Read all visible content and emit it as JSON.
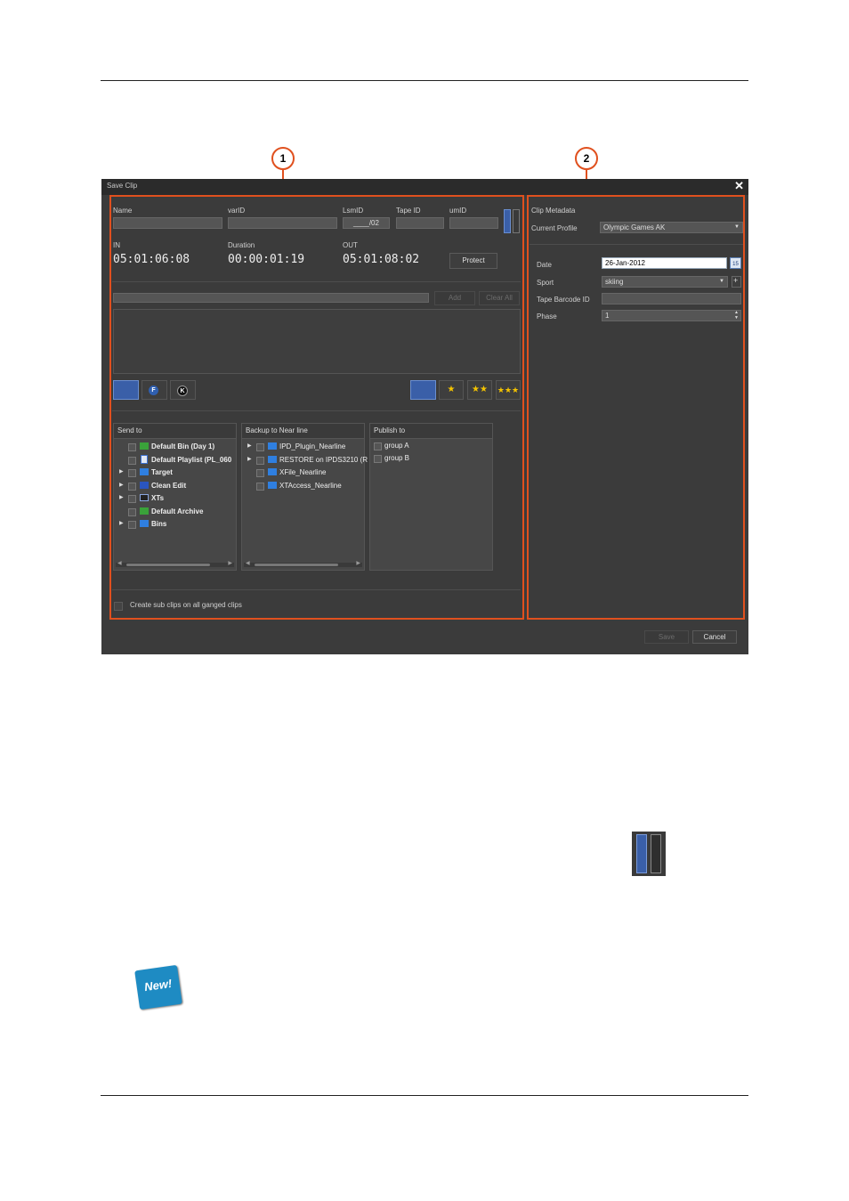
{
  "callouts": [
    "1",
    "2"
  ],
  "dialog": {
    "title": "Save Clip",
    "close_glyph": "✕",
    "fields": {
      "name_label": "Name",
      "varid_label": "varID",
      "lsmid_label": "LsmID",
      "lsmid_value": "____/02",
      "tapeid_label": "Tape ID",
      "umid_label": "umID"
    },
    "timecodes": {
      "in_label": "IN",
      "in_value": "05:01:06:08",
      "duration_label": "Duration",
      "duration_value": "00:00:01:19",
      "out_label": "OUT",
      "out_value": "05:01:08:02",
      "protect_label": "Protect"
    },
    "keywords": {
      "add_label": "Add",
      "clear_all_label": "Clear All"
    },
    "rating": {
      "f_label": "F",
      "k_label": "K",
      "one_star": "★",
      "two_stars": "★★",
      "three_stars": "★★★"
    },
    "send_to": {
      "header": "Send to",
      "items": [
        {
          "label": "Default Bin (Day 1)",
          "icon": "green-folder-icon",
          "expandable": false
        },
        {
          "label": "Default Playlist (PL_060",
          "icon": "playlist-icon",
          "expandable": false
        },
        {
          "label": "Target",
          "icon": "blue-folder-icon",
          "expandable": true
        },
        {
          "label": "Clean Edit",
          "icon": "clean-edit-icon",
          "expandable": true
        },
        {
          "label": "XTs",
          "icon": "xt-icon",
          "expandable": true
        },
        {
          "label": "Default Archive",
          "icon": "green-folder-icon",
          "expandable": false
        },
        {
          "label": "Bins",
          "icon": "blue-folder-icon",
          "expandable": true
        }
      ]
    },
    "backup": {
      "header": "Backup to Near line",
      "items": [
        {
          "label": "IPD_Plugin_Nearline",
          "expandable": true
        },
        {
          "label": "RESTORE on IPDS3210 (R",
          "expandable": true
        },
        {
          "label": "XFile_Nearline",
          "expandable": false
        },
        {
          "label": "XTAccess_Nearline",
          "expandable": false
        }
      ]
    },
    "publish": {
      "header": "Publish to",
      "items": [
        "group A",
        "group B"
      ]
    },
    "subclips_label": "Create sub clips on all ganged clips",
    "metadata": {
      "header": "Clip Metadata",
      "profile_label": "Current Profile",
      "profile_value": "Olympic Games AK",
      "date_label": "Date",
      "date_value": "26-Jan-2012",
      "calendar_glyph": "15",
      "sport_label": "Sport",
      "sport_value": "skiing",
      "plus_glyph": "+",
      "tape_barcode_label": "Tape Barcode ID",
      "phase_label": "Phase",
      "phase_value": "1"
    },
    "save_label": "Save",
    "cancel_label": "Cancel"
  },
  "new_badge": "New!",
  "colors": {
    "callout_orange": "#e0501e",
    "accent_blue": "#3a5fa8",
    "dialog_bg": "#3b3b3b",
    "star_yellow": "#f5c400",
    "badge_blue": "#1e8bc3"
  }
}
